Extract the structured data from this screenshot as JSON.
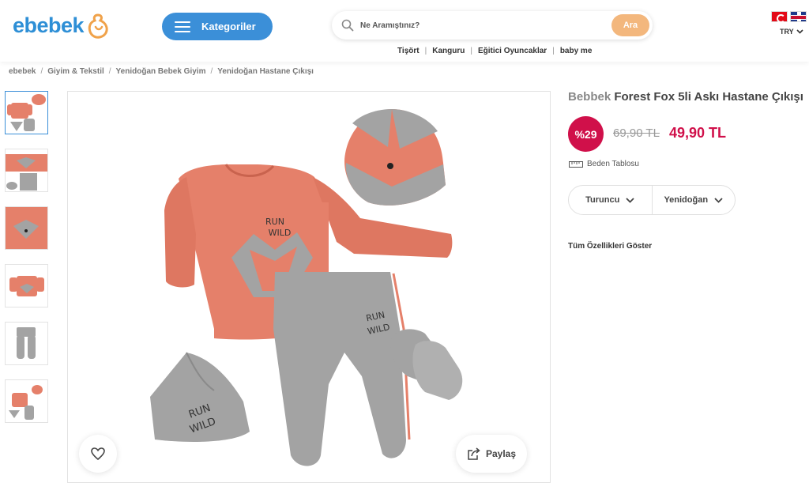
{
  "header": {
    "logo_text": "ebebek",
    "categories_label": "Kategoriler",
    "search": {
      "placeholder": "Ne Aramıştınız?",
      "button_label": "Ara"
    },
    "quick_links": [
      "Tişört",
      "Kanguru",
      "Eğitici Oyuncaklar",
      "baby me"
    ],
    "currency": "TRY",
    "colors": {
      "brand_blue": "#2e8fd6",
      "categories_bg": "#3b8fd8",
      "search_button": "#f3b77d",
      "logo_orange": "#f0a24a"
    }
  },
  "breadcrumb": [
    "ebebek",
    "Giyim & Tekstil",
    "Yenidoğan Bebek Giyim",
    "Yenidoğan Hastane Çıkışı"
  ],
  "gallery": {
    "thumbnails": [
      "full-set",
      "set-detail",
      "sweatshirt-closeup",
      "sweatshirt",
      "pants",
      "set-small"
    ],
    "active_index": 0,
    "share_label": "Paylaş"
  },
  "product": {
    "brand": "Bebbek",
    "name": "Forest Fox 5li Askı Hastane Çıkışı",
    "discount": "%29",
    "old_price": "69,90 TL",
    "new_price": "49,90 TL",
    "size_table_label": "Beden Tablosu",
    "variants": [
      {
        "label": "Turuncu"
      },
      {
        "label": "Yenidoğan"
      }
    ],
    "all_features_label": "Tüm Özellikleri Göster",
    "colors": {
      "price_red": "#d0104a",
      "shirt_orange": "#e5806a",
      "pants_gray": "#a3a3a3"
    }
  }
}
